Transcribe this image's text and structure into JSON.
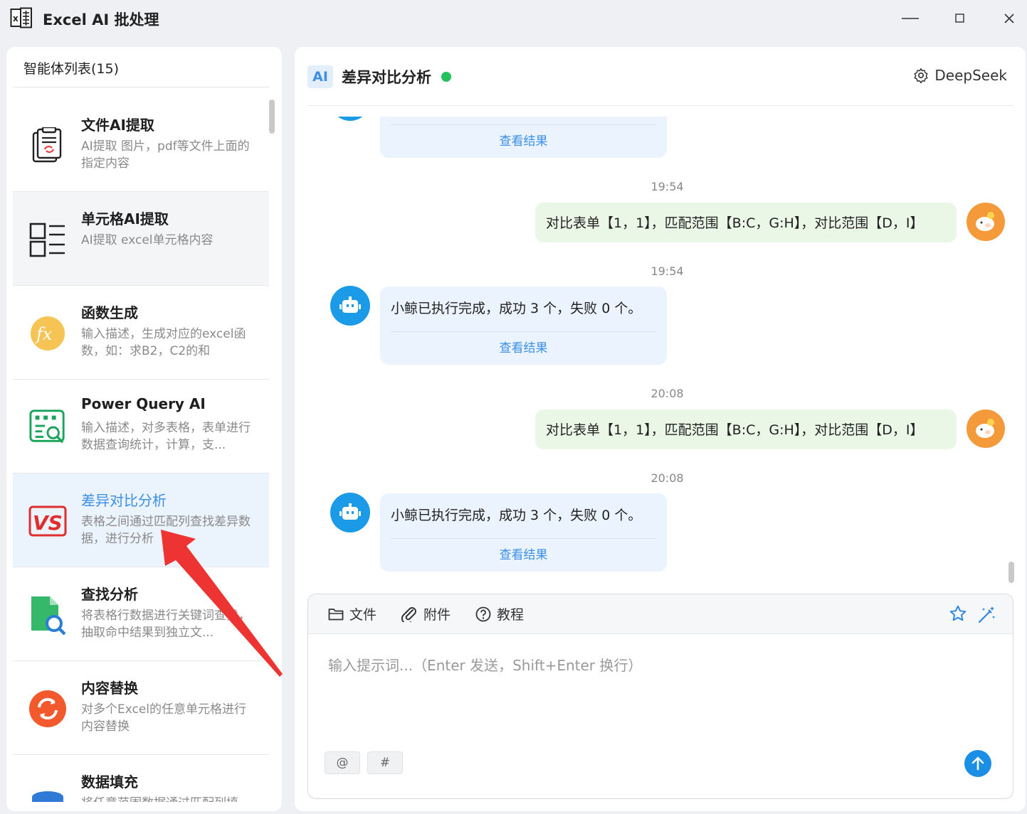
{
  "app": {
    "title": "Excel AI 批处理",
    "logo_icon": "excel-logo-icon"
  },
  "window_controls": {
    "minimize": "minimize-icon",
    "maximize": "maximize-icon",
    "close": "close-icon"
  },
  "sidebar": {
    "header": "智能体列表(15)",
    "items": [
      {
        "name": "文件AI提取",
        "desc": "AI提取 图片，pdf等文件上面的指定内容",
        "icon": "file-extract-icon"
      },
      {
        "name": "单元格AI提取",
        "desc": "AI提取 excel单元格内容",
        "icon": "cell-list-icon"
      },
      {
        "name": "函数生成",
        "desc": "输入描述，生成对应的excel函数，如：求B2，C2的和",
        "icon": "fx-icon"
      },
      {
        "name": "Power Query AI",
        "desc": "输入描述，对多表格，表单进行数据查询统计，计算，支...",
        "icon": "query-icon"
      },
      {
        "name": "差异对比分析",
        "desc": "表格之间通过匹配列查找差异数据，进行分析",
        "icon": "vs-icon"
      },
      {
        "name": "查找分析",
        "desc": "将表格行数据进行关键词查找，抽取命中结果到独立文...",
        "icon": "search-doc-icon"
      },
      {
        "name": "内容替换",
        "desc": "对多个Excel的任意单元格进行内容替换",
        "icon": "replace-icon"
      },
      {
        "name": "数据填充",
        "desc": "将任意范围数据通过匹配列填",
        "icon": "database-icon"
      }
    ],
    "selected_index": 4
  },
  "chat": {
    "agent_badge": "AI",
    "title": "差异对比分析",
    "status_color": "#21c15b",
    "model": "DeepSeek",
    "view_result_label": "查看结果",
    "messages": [
      {
        "role": "bot",
        "text": "",
        "link": "查看结果"
      },
      {
        "role": "user",
        "time": "19:54",
        "text": "对比表单【1，1】，匹配范围【B:C，G:H】，对比范围【D，I】"
      },
      {
        "role": "bot",
        "time": "19:54",
        "text": "小鲸已执行完成，成功 3 个，失败 0 个。",
        "link": "查看结果"
      },
      {
        "role": "user",
        "time": "20:08",
        "text": "对比表单【1，1】，匹配范围【B:C，G:H】，对比范围【D，I】"
      },
      {
        "role": "bot",
        "time": "20:08",
        "text": "小鲸已执行完成，成功 3 个，失败 0 个。",
        "link": "查看结果"
      }
    ]
  },
  "composer": {
    "file_label": "文件",
    "attach_label": "附件",
    "tutorial_label": "教程",
    "placeholder": "输入提示词...（Enter 发送，Shift+Enter 换行）",
    "value": "",
    "chip_at": "@",
    "chip_hash": "#"
  },
  "colors": {
    "accent": "#3b8fe6",
    "user_bubble": "#eaf6e6",
    "bot_bubble": "#eaf3fe",
    "annotation_arrow": "#ee3333"
  }
}
